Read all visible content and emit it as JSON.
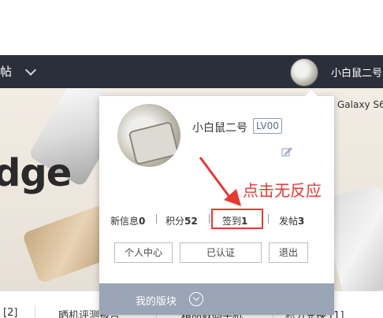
{
  "topbar": {
    "left_text": "帖",
    "username": "小白鼠二号"
  },
  "hero": {
    "brand_text": "dge",
    "product_text": "Galaxy S6"
  },
  "tabs": [
    {
      "label": "[2]"
    },
    {
      "label": "晒机评测报告"
    },
    {
      "label": "精品数码手机"
    },
    {
      "label": "积分兑换 [1]"
    }
  ],
  "profile": {
    "username": "小白鼠二号",
    "level": "LV00",
    "stats": {
      "messages_label": "新信息",
      "messages_value": "0",
      "points_label": "积分",
      "points_value": "52",
      "checkin_label": "签到",
      "checkin_value": "1",
      "posts_label": "发帖",
      "posts_value": "3"
    },
    "buttons": {
      "personal_center": "个人中心",
      "verified": "已认证",
      "logout": "退出"
    },
    "footer": {
      "my_sections": "我的版块"
    }
  },
  "annotation": {
    "text": "点击无反应",
    "color": "#e53935"
  },
  "colors": {
    "topbar": "#2b2f3a",
    "footer": "#9aa6b5",
    "level_badge": "#5d6b8a"
  }
}
